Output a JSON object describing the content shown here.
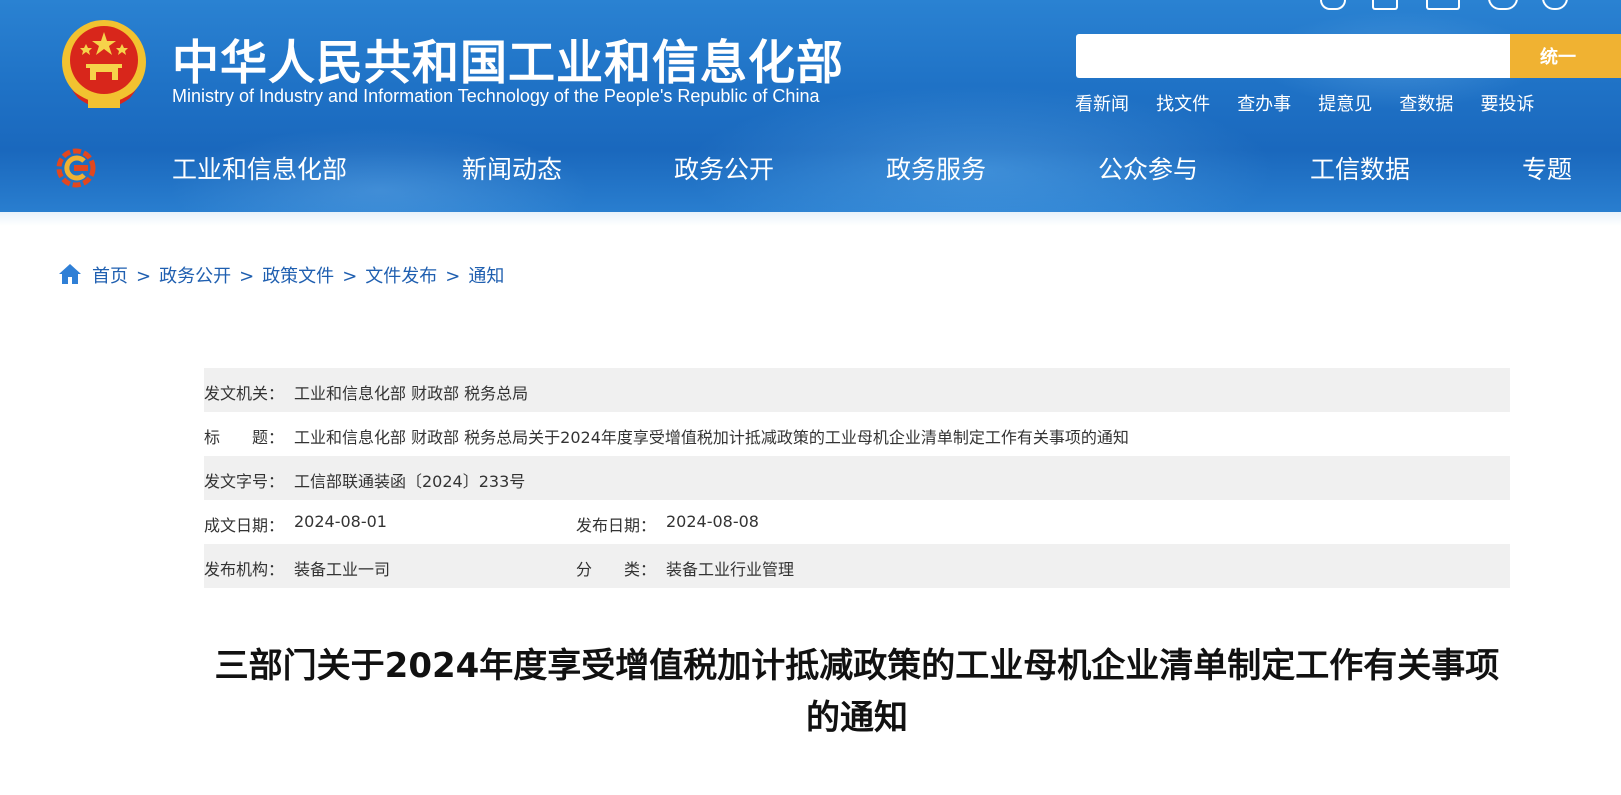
{
  "header": {
    "title_cn": "中华人民共和国工业和信息化部",
    "title_en": "Ministry of Industry and Information Technology of the People's Republic of China",
    "search": {
      "placeholder": "",
      "button_label": "统一"
    },
    "quick_links": [
      "看新闻",
      "找文件",
      "查办事",
      "提意见",
      "查数据",
      "要投诉"
    ],
    "nav": [
      "工业和信息化部",
      "新闻动态",
      "政务公开",
      "政务服务",
      "公众参与",
      "工信数据",
      "专题"
    ]
  },
  "breadcrumb": [
    "首页",
    "政务公开",
    "政策文件",
    "文件发布",
    "通知"
  ],
  "meta": {
    "issuer_label": "发文机关：",
    "issuer": "工业和信息化部 财政部 税务总局",
    "title_label": "标　　题：",
    "title": "工业和信息化部 财政部 税务总局关于2024年度享受增值税加计抵减政策的工业母机企业清单制定工作有关事项的通知",
    "doc_no_label": "发文字号：",
    "doc_no": "工信部联通装函〔2024〕233号",
    "written_date_label": "成文日期：",
    "written_date": "2024-08-01",
    "publish_date_label": "发布日期：",
    "publish_date": "2024-08-08",
    "agency_label": "发布机构：",
    "agency": "装备工业一司",
    "category_label": "分　　类：",
    "category": "装备工业行业管理"
  },
  "article": {
    "title": "三部门关于2024年度享受增值税加计抵减政策的工业母机企业清单制定工作有关事项的通知"
  },
  "colors": {
    "header_blue": "#1f72c6",
    "search_button": "#f0b232",
    "link_blue": "#1f5fb0",
    "row_shade": "#f0f0f0"
  }
}
